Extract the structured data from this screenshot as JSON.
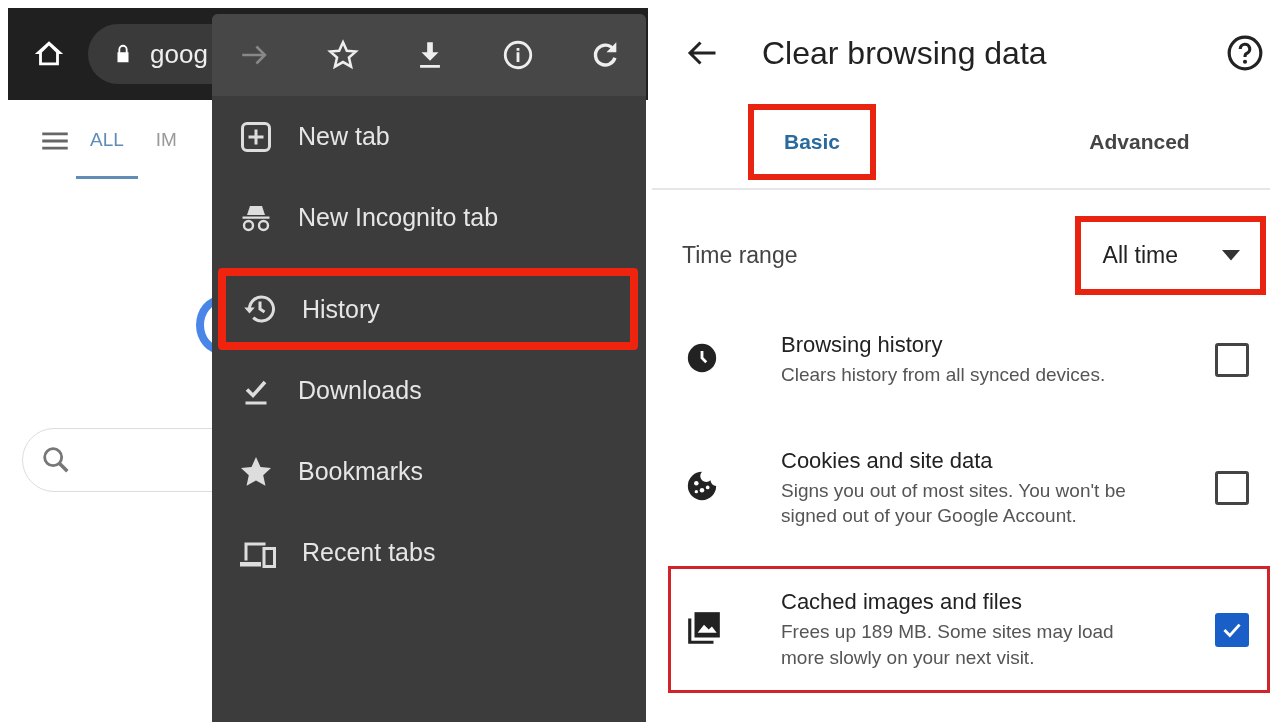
{
  "left": {
    "toolbar": {
      "url": "goog"
    },
    "page_tabs": [
      {
        "label": "ALL",
        "selected": true
      },
      {
        "label": "IM",
        "selected": false
      }
    ],
    "menu": {
      "actions": [
        {
          "kind": "forward",
          "disabled": true
        },
        {
          "kind": "bookmark",
          "disabled": false
        },
        {
          "kind": "download",
          "disabled": false
        },
        {
          "kind": "info",
          "disabled": false
        },
        {
          "kind": "refresh",
          "disabled": false
        }
      ],
      "items": [
        {
          "label": "New tab",
          "kind": "new-tab",
          "highlighted": false
        },
        {
          "label": "New Incognito tab",
          "kind": "incognito",
          "highlighted": false
        },
        {
          "label": "History",
          "kind": "history",
          "highlighted": true
        },
        {
          "label": "Downloads",
          "kind": "downloads",
          "highlighted": false
        },
        {
          "label": "Bookmarks",
          "kind": "bookmarks",
          "highlighted": false
        },
        {
          "label": "Recent tabs",
          "kind": "recent",
          "highlighted": false
        }
      ]
    }
  },
  "right": {
    "title": "Clear browsing data",
    "tabs": [
      {
        "label": "Basic",
        "selected": true,
        "highlighted": true
      },
      {
        "label": "Advanced",
        "selected": false,
        "highlighted": false
      }
    ],
    "time_range": {
      "label": "Time range",
      "value": "All time",
      "highlighted": true
    },
    "options": [
      {
        "kind": "history",
        "title": "Browsing history",
        "description": "Clears history from all synced devices.",
        "checked": false,
        "highlighted": false
      },
      {
        "kind": "cookies",
        "title": "Cookies and site data",
        "description": "Signs you out of most sites. You won't be signed out of your Google Account.",
        "checked": false,
        "highlighted": false
      },
      {
        "kind": "cache",
        "title": "Cached images and files",
        "description": "Frees up 189 MB. Some sites may load more slowly on your next visit.",
        "checked": true,
        "highlighted": true
      }
    ]
  }
}
